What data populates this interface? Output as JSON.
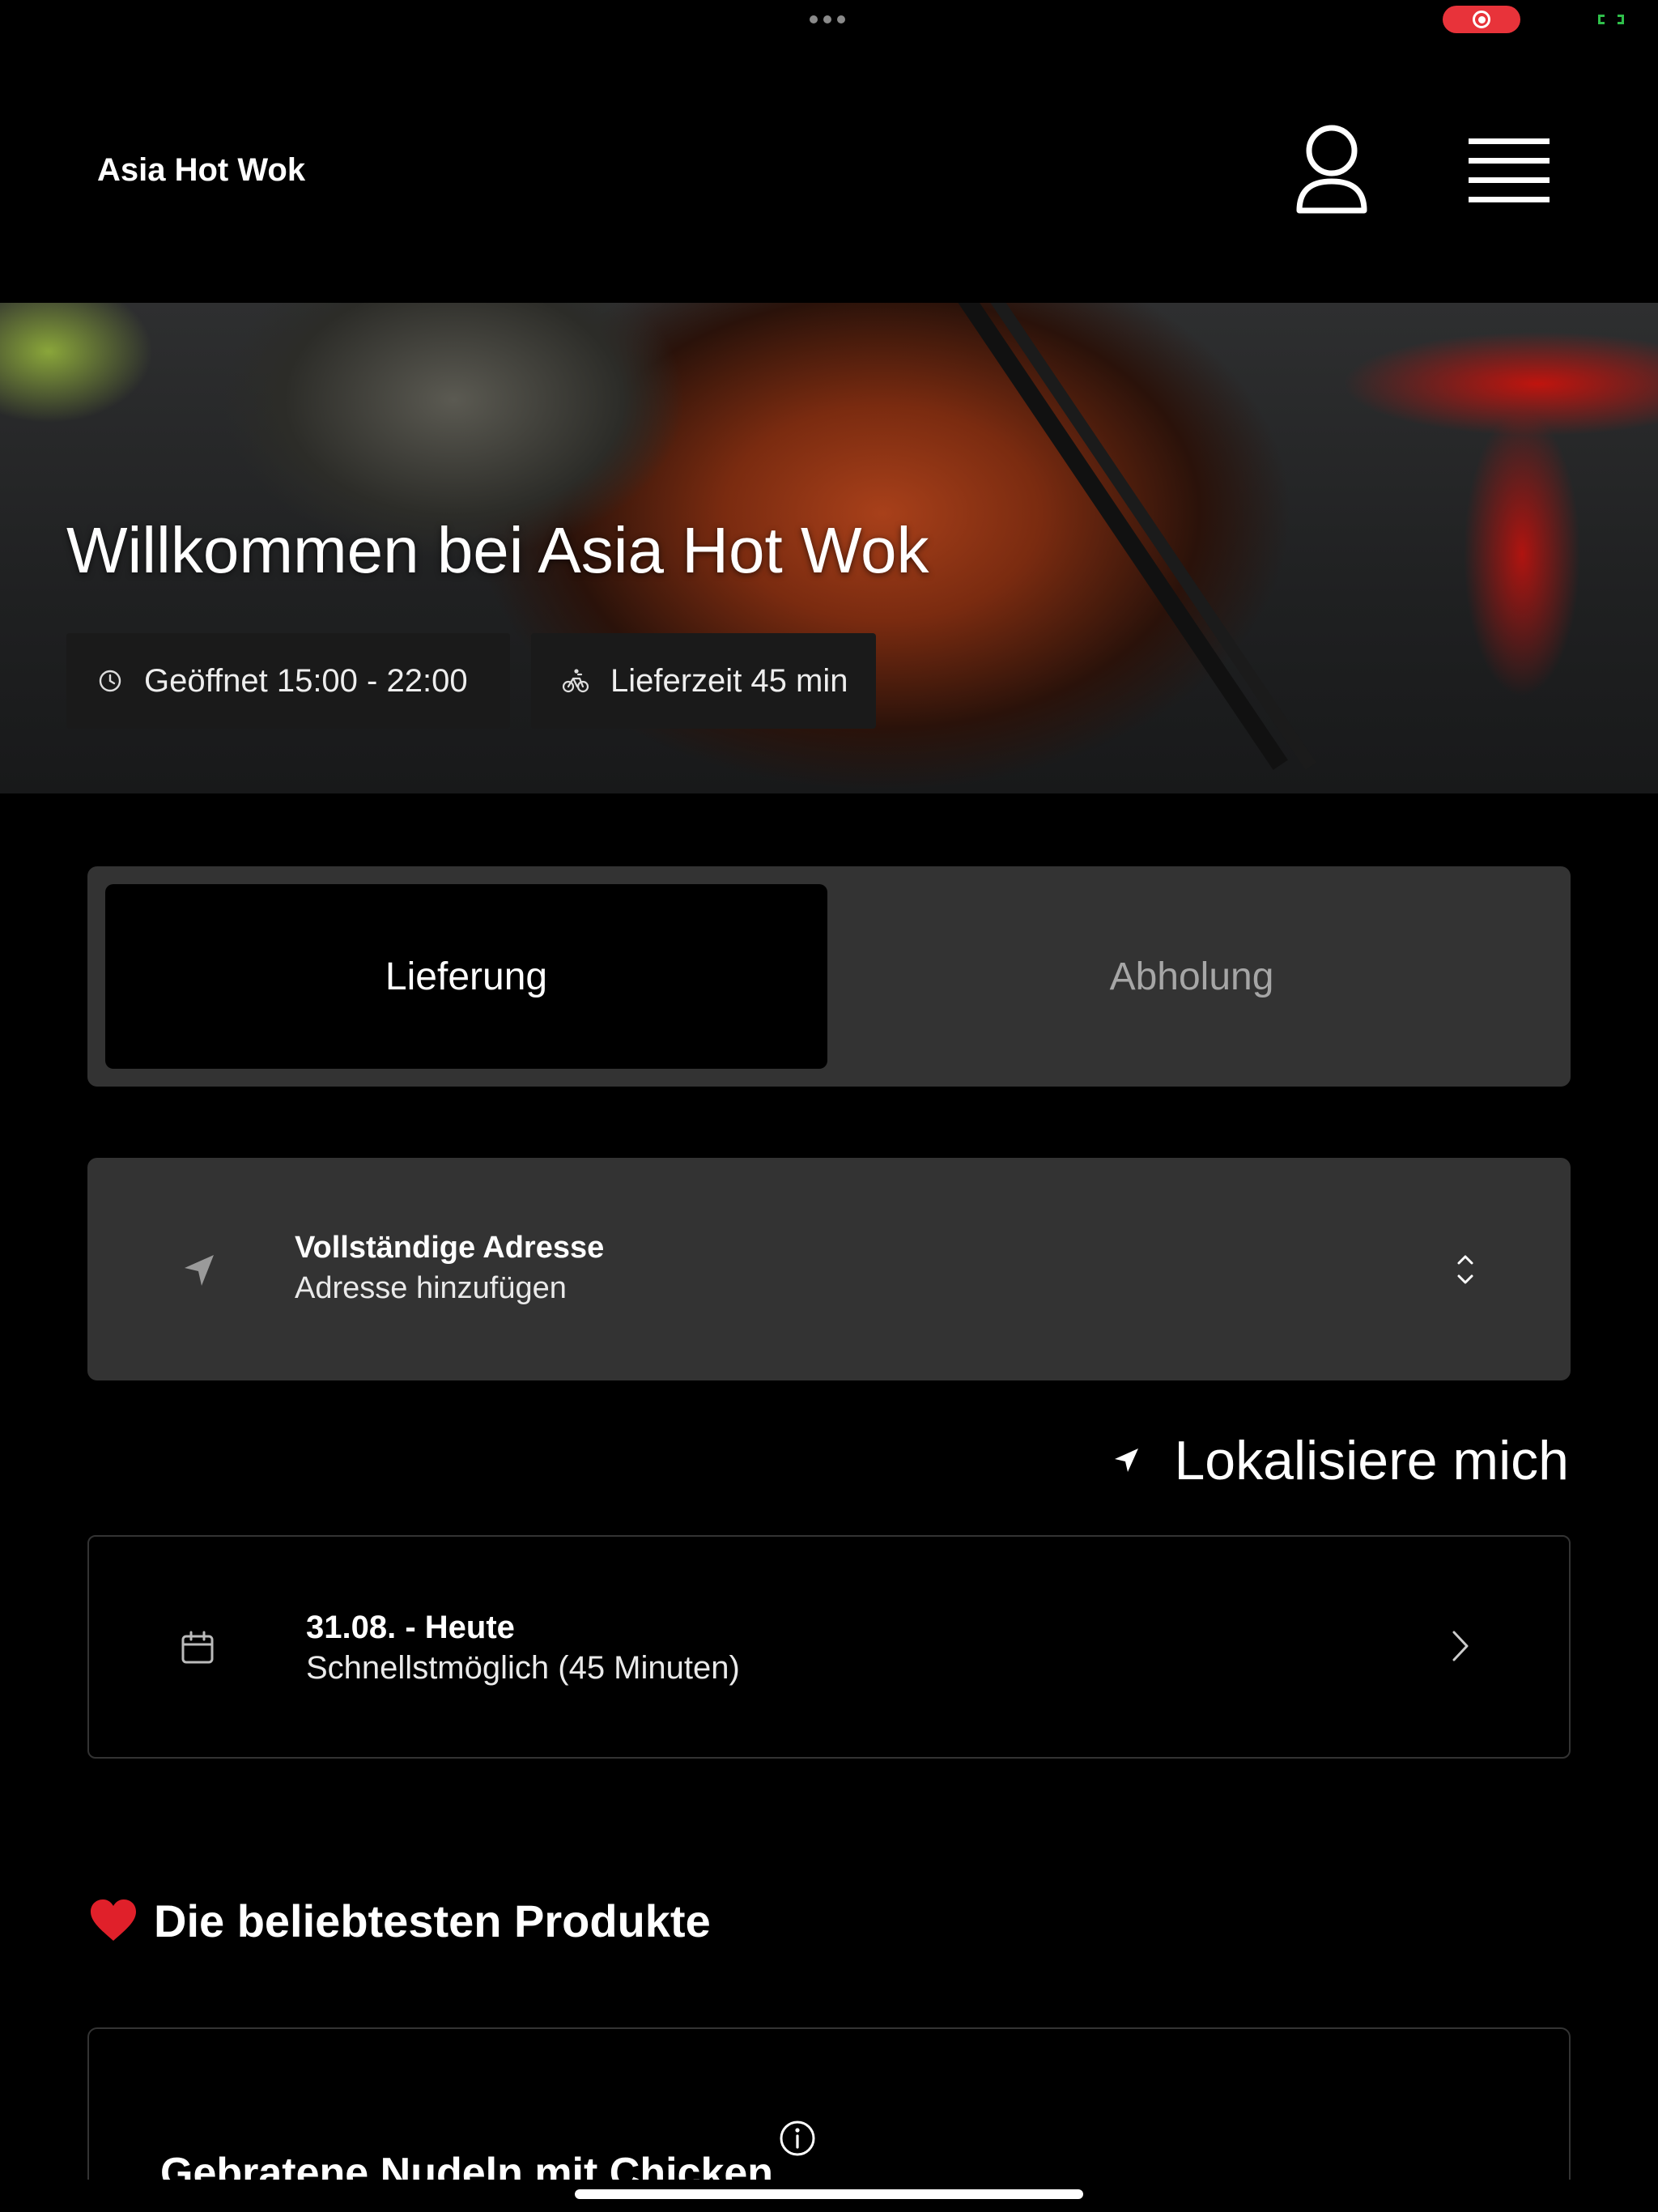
{
  "app": {
    "brand": "Asia Hot Wok"
  },
  "hero": {
    "title": "Willkommen bei Asia Hot Wok",
    "opening_hours": "Geöffnet 15:00 - 22:00",
    "delivery_time": "Lieferzeit 45 min"
  },
  "mode": {
    "delivery_label": "Lieferung",
    "pickup_label": "Abholung",
    "selected": "Lieferung"
  },
  "address": {
    "title": "Vollständige Adresse",
    "value": "Adresse hinzufügen"
  },
  "locate": {
    "label": "Lokalisiere mich"
  },
  "schedule": {
    "date": "31.08. - Heute",
    "time": "Schnellstmöglich (45 Minuten)"
  },
  "popular": {
    "heading": "Die beliebtesten Produkte",
    "products": [
      {
        "name": "Gebratene Nudeln mit Chicken"
      }
    ]
  },
  "icons": {
    "status": "more-dots-icon",
    "recording": "screen-recording-icon",
    "battery": "battery-icon",
    "profile": "user-icon",
    "menu": "hamburger-menu-icon",
    "clock": "clock-icon",
    "bike": "bicycle-icon",
    "location": "location-arrow-icon",
    "chevron_updown": "chevron-up-down-icon",
    "calendar": "calendar-icon",
    "chevron_right": "chevron-right-icon",
    "heart": "heart-icon",
    "info": "info-icon"
  },
  "colors": {
    "background": "#000000",
    "card": "#333333",
    "muted_text": "#a6a6a6",
    "heart": "#e0202a",
    "recording": "#e8333a"
  }
}
